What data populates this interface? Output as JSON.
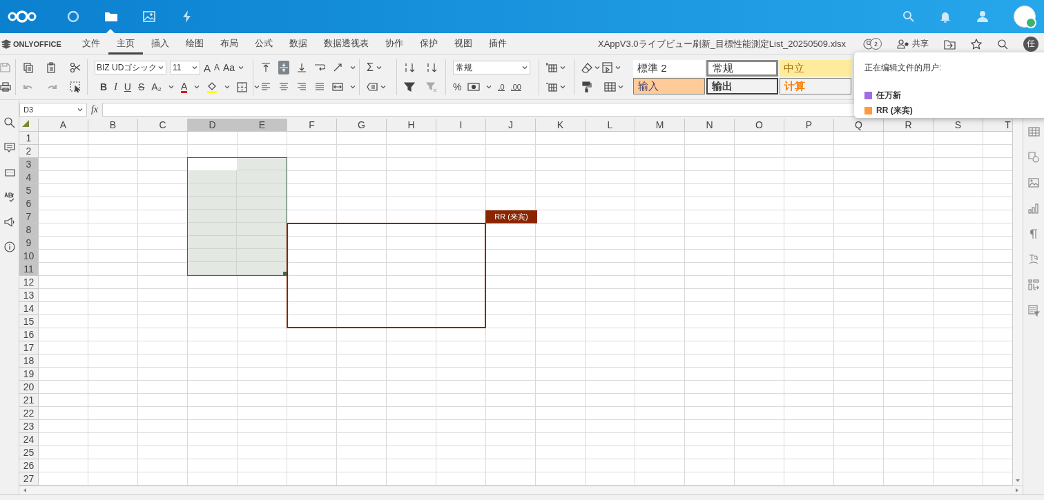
{
  "header": {
    "apps": [
      {
        "selected": false
      },
      {
        "selected": true
      },
      {
        "selected": false
      },
      {
        "selected": false
      }
    ]
  },
  "app_bar": {
    "logo": "ONLYOFFICE",
    "tabs": [
      {
        "label": "文件",
        "selected": false
      },
      {
        "label": "主页",
        "selected": true
      },
      {
        "label": "插入",
        "selected": false
      },
      {
        "label": "绘图",
        "selected": false
      },
      {
        "label": "布局",
        "selected": false
      },
      {
        "label": "公式",
        "selected": false
      },
      {
        "label": "数据",
        "selected": false
      },
      {
        "label": "数据透视表",
        "selected": false
      },
      {
        "label": "协作",
        "selected": false
      },
      {
        "label": "保护",
        "selected": false
      },
      {
        "label": "视图",
        "selected": false
      },
      {
        "label": "插件",
        "selected": false
      }
    ],
    "file_title": "XAppV3.0ライブビュー刷新_目標性能測定List_20250509.xlsx",
    "users_count": "2",
    "share": "共享",
    "avatar": "任"
  },
  "toolbar": {
    "font": "BIZ UDゴシック",
    "font_size": "11",
    "number_format": "常规",
    "glyphs": [
      "A",
      "A",
      "Aa",
      "B",
      "I",
      "U",
      "S",
      "A₂",
      "A",
      "Σ",
      "%",
      ".0",
      ".00"
    ],
    "styles": [
      {
        "label": "標準 2",
        "kind": "plain"
      },
      {
        "label": "常规",
        "kind": "normal"
      },
      {
        "label": "中立",
        "kind": "neutral"
      },
      {
        "label": "输入",
        "kind": "input"
      },
      {
        "label": "输出",
        "kind": "output"
      },
      {
        "label": "计算",
        "kind": "calc"
      }
    ]
  },
  "formula_bar": {
    "cell": "D3",
    "fx": "fx"
  },
  "sheet": {
    "columns": [
      {
        "label": "A",
        "selected": false
      },
      {
        "label": "B",
        "selected": false
      },
      {
        "label": "C",
        "selected": false
      },
      {
        "label": "D",
        "selected": true
      },
      {
        "label": "E",
        "selected": true
      },
      {
        "label": "F",
        "selected": false
      },
      {
        "label": "G",
        "selected": false
      },
      {
        "label": "H",
        "selected": false
      },
      {
        "label": "I",
        "selected": false
      },
      {
        "label": "J",
        "selected": false
      },
      {
        "label": "K",
        "selected": false
      },
      {
        "label": "L",
        "selected": false
      },
      {
        "label": "M",
        "selected": false
      },
      {
        "label": "N",
        "selected": false
      },
      {
        "label": "O",
        "selected": false
      },
      {
        "label": "P",
        "selected": false
      },
      {
        "label": "Q",
        "selected": false
      },
      {
        "label": "R",
        "selected": false
      },
      {
        "label": "S",
        "selected": false
      },
      {
        "label": "T",
        "selected": false
      }
    ],
    "rows": [
      {
        "label": "1",
        "selected": false
      },
      {
        "label": "2",
        "selected": false
      },
      {
        "label": "3",
        "selected": true
      },
      {
        "label": "4",
        "selected": true
      },
      {
        "label": "5",
        "selected": true
      },
      {
        "label": "6",
        "selected": true
      },
      {
        "label": "7",
        "selected": true
      },
      {
        "label": "8",
        "selected": true
      },
      {
        "label": "9",
        "selected": true
      },
      {
        "label": "10",
        "selected": true
      },
      {
        "label": "11",
        "selected": true
      },
      {
        "label": "12",
        "selected": false
      },
      {
        "label": "13",
        "selected": false
      },
      {
        "label": "14",
        "selected": false
      },
      {
        "label": "15",
        "selected": false
      },
      {
        "label": "16",
        "selected": false
      },
      {
        "label": "17",
        "selected": false
      },
      {
        "label": "18",
        "selected": false
      },
      {
        "label": "19",
        "selected": false
      },
      {
        "label": "20",
        "selected": false
      },
      {
        "label": "21",
        "selected": false
      },
      {
        "label": "22",
        "selected": false
      },
      {
        "label": "23",
        "selected": false
      },
      {
        "label": "24",
        "selected": false
      },
      {
        "label": "25",
        "selected": false
      },
      {
        "label": "26",
        "selected": false
      },
      {
        "label": "27",
        "selected": false
      }
    ]
  },
  "collaborator": {
    "label": "RR (来宾)",
    "color": "#8b2500"
  },
  "editors_popup": {
    "title": "正在编辑文件的用户:",
    "users": [
      {
        "name": "任万新",
        "color": "#a06ee0"
      },
      {
        "name": "RR (来宾)",
        "color": "#ff9a3c"
      }
    ]
  }
}
